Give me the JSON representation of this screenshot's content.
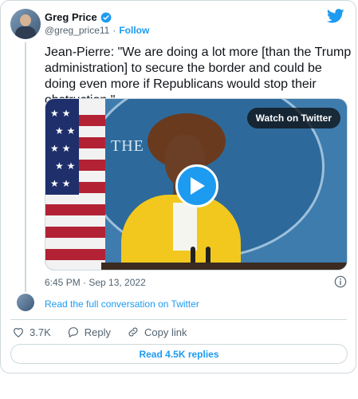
{
  "author": {
    "name": "Greg Price",
    "handle": "@greg_price11",
    "separator": "·",
    "follow_label": "Follow"
  },
  "tweet": {
    "text": "Jean-Pierre: \"We are doing a lot more [than the Trump administration] to secure the border and could be doing even more if Republicans would stop their obstruction.\"",
    "timestamp": "6:45 PM · Sep 13, 2022"
  },
  "media": {
    "watch_label": "Watch on Twitter",
    "seal_text": "THE W      OUSE"
  },
  "conversation": {
    "link_label": "Read the full conversation on Twitter"
  },
  "actions": {
    "likes": "3.7K",
    "reply_label": "Reply",
    "copy_label": "Copy link"
  },
  "replies_button": "Read 4.5K replies",
  "colors": {
    "accent": "#1d9bf0",
    "muted": "#536471",
    "border": "#cfd9de"
  }
}
